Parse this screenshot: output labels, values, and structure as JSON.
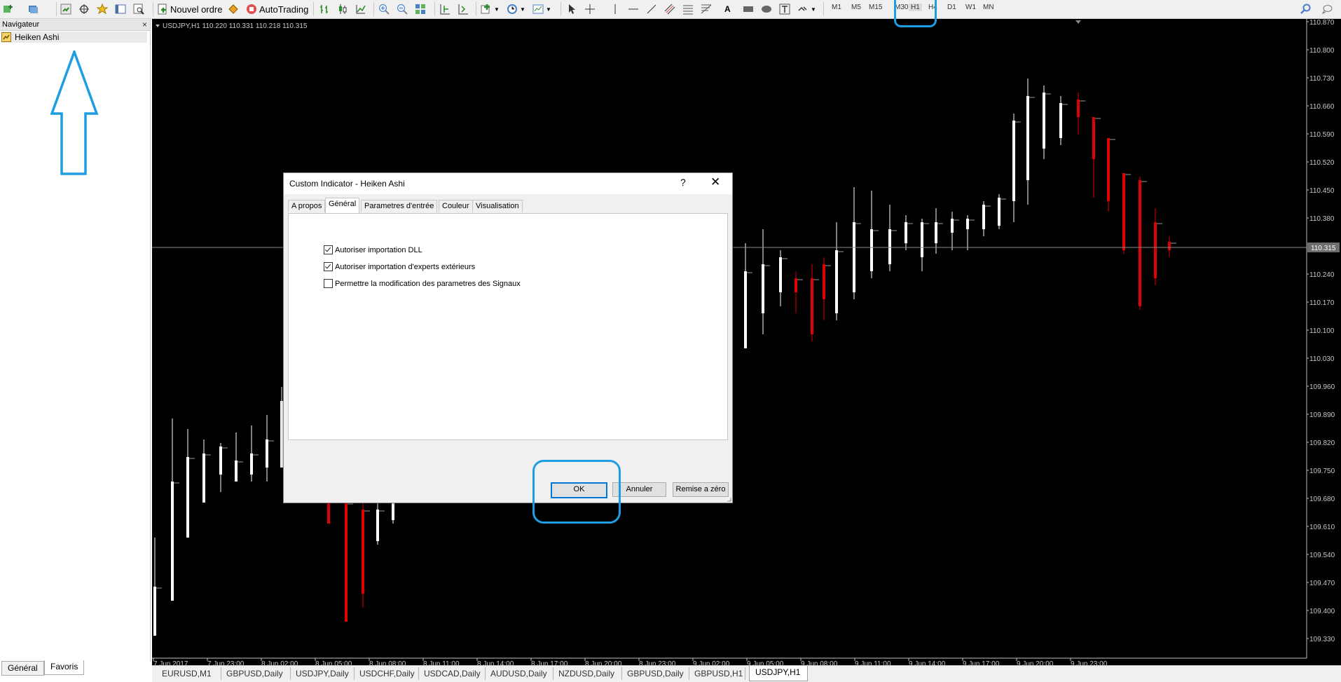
{
  "toolbar": {
    "new_order_label": "Nouvel ordre",
    "autotrading_label": "AutoTrading",
    "text_tool_label": "A",
    "timeframes": [
      "M1",
      "M5",
      "M15",
      "M30",
      "H1",
      "H4",
      "D1",
      "W1",
      "MN"
    ]
  },
  "navigator": {
    "title": "Navigateur",
    "close": "×",
    "item": "Heiken Ashi",
    "tabs": [
      "Général",
      "Favoris"
    ]
  },
  "chart": {
    "info": "USDJPY,H1  110.220 110.331 110.218 110.315",
    "current_price": "110.315",
    "price_labels": [
      "110.870",
      "110.800",
      "110.730",
      "110.660",
      "110.590",
      "110.520",
      "110.450",
      "110.380",
      "110.240",
      "110.170",
      "110.100",
      "110.030",
      "109.960",
      "109.890",
      "109.820",
      "109.750",
      "109.680",
      "109.610",
      "109.540",
      "109.470",
      "109.400",
      "109.330"
    ],
    "time_labels": [
      "7 Jun 2017",
      "7 Jun 23:00",
      "8 Jun 02:00",
      "8 Jun 05:00",
      "8 Jun 08:00",
      "8 Jun 11:00",
      "8 Jun 14:00",
      "8 Jun 17:00",
      "8 Jun 20:00",
      "8 Jun 23:00",
      "9 Jun 02:00",
      "9 Jun 05:00",
      "9 Jun 08:00",
      "9 Jun 11:00",
      "9 Jun 14:00",
      "9 Jun 17:00",
      "9 Jun 20:00",
      "9 Jun 23:00"
    ],
    "colors": {
      "bull": "#ffffff",
      "bear": "#e00000",
      "grid": "#8a8a8a"
    }
  },
  "symbol_tabs": [
    "EURUSD,M1",
    "GBPUSD,Daily",
    "USDJPY,Daily",
    "USDCHF,Daily",
    "USDCAD,Daily",
    "AUDUSD,Daily",
    "NZDUSD,Daily",
    "GBPUSD,Daily",
    "GBPUSD,H1",
    "USDJPY,H1"
  ],
  "dialog": {
    "title": "Custom Indicator - Heiken Ashi",
    "help": "?",
    "close": "✕",
    "tabs": [
      "A propos",
      "Général",
      "Parametres d'entrée",
      "Couleur",
      "Visualisation"
    ],
    "options": [
      {
        "label": "Autoriser importation DLL",
        "checked": true
      },
      {
        "label": "Autoriser importation d'experts extérieurs",
        "checked": true
      },
      {
        "label": "Permettre la modification des parametres des Signaux",
        "checked": false
      }
    ],
    "ok": "OK",
    "cancel": "Annuler",
    "reset": "Remise a zéro"
  },
  "annotation_color": "#1e9ee0"
}
